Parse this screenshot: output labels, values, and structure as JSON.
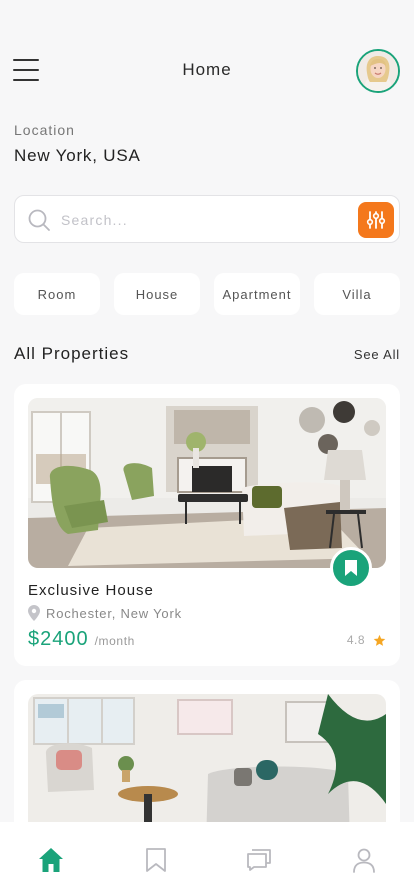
{
  "header": {
    "title": "Home",
    "menu_icon": "hamburger-menu-icon",
    "avatar": "user-avatar"
  },
  "location": {
    "label": "Location",
    "value": "New York, USA"
  },
  "search": {
    "placeholder": "Search...",
    "value": "",
    "icon": "search-icon",
    "filter_icon": "sliders-icon"
  },
  "categories": [
    "Room",
    "House",
    "Apartment",
    "Villa"
  ],
  "section": {
    "title": "All Properties",
    "see_all": "See All"
  },
  "properties": [
    {
      "name": "Exclusive House",
      "location": "Rochester, New York",
      "price": "$2400",
      "price_unit": "/month",
      "rating": "4.8"
    }
  ],
  "tabbar": {
    "items": [
      "home-icon",
      "bookmark-icon",
      "chat-icon",
      "profile-icon"
    ],
    "active": "home-icon"
  },
  "colors": {
    "accent": "#1aa37a",
    "filter": "#f4781c",
    "star": "#f5a623",
    "background": "#f7f7f8"
  }
}
